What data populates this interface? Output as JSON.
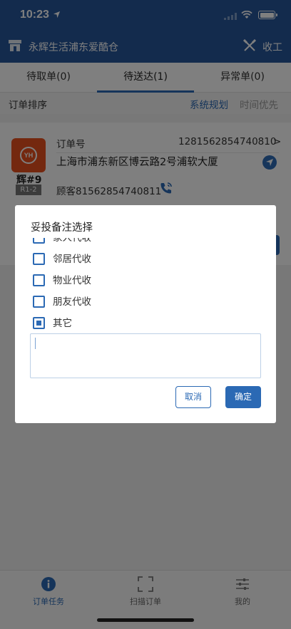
{
  "status_bar": {
    "time": "10:23"
  },
  "header": {
    "store_name": "永辉生活浦东爱酷仓",
    "finish_label": "收工"
  },
  "tabs": [
    {
      "label": "待取单(0)"
    },
    {
      "label": "待送达(1)",
      "active": true
    },
    {
      "label": "异常单(0)"
    }
  ],
  "sort_bar": {
    "label": "订单排序",
    "option_system": "系统规划",
    "option_time": "时间优先"
  },
  "order": {
    "shop_code": "辉#9",
    "shelf": "R1-2",
    "order_no_label": "订单号",
    "order_no": "1281562854740810",
    "chevron": ">",
    "address": "上海市浦东新区博云路2号浦软大厦",
    "customer": "顾客81562854740811"
  },
  "dialog": {
    "title": "妥投备注选择",
    "options": [
      {
        "label": "家人代收",
        "checked": false
      },
      {
        "label": "邻居代收",
        "checked": false
      },
      {
        "label": "物业代收",
        "checked": false
      },
      {
        "label": "朋友代收",
        "checked": false
      },
      {
        "label": "其它",
        "checked": true
      }
    ],
    "remark_value": "",
    "cancel_label": "取消",
    "confirm_label": "确定"
  },
  "bottom_nav": [
    {
      "label": "订单任务",
      "icon": "info-icon",
      "active": true
    },
    {
      "label": "扫描订单",
      "icon": "scan-icon",
      "active": false
    },
    {
      "label": "我的",
      "icon": "sliders-icon",
      "active": false
    }
  ],
  "colors": {
    "primary": "#26569a",
    "accent": "#2b69b4",
    "logo": "#e8501f"
  }
}
